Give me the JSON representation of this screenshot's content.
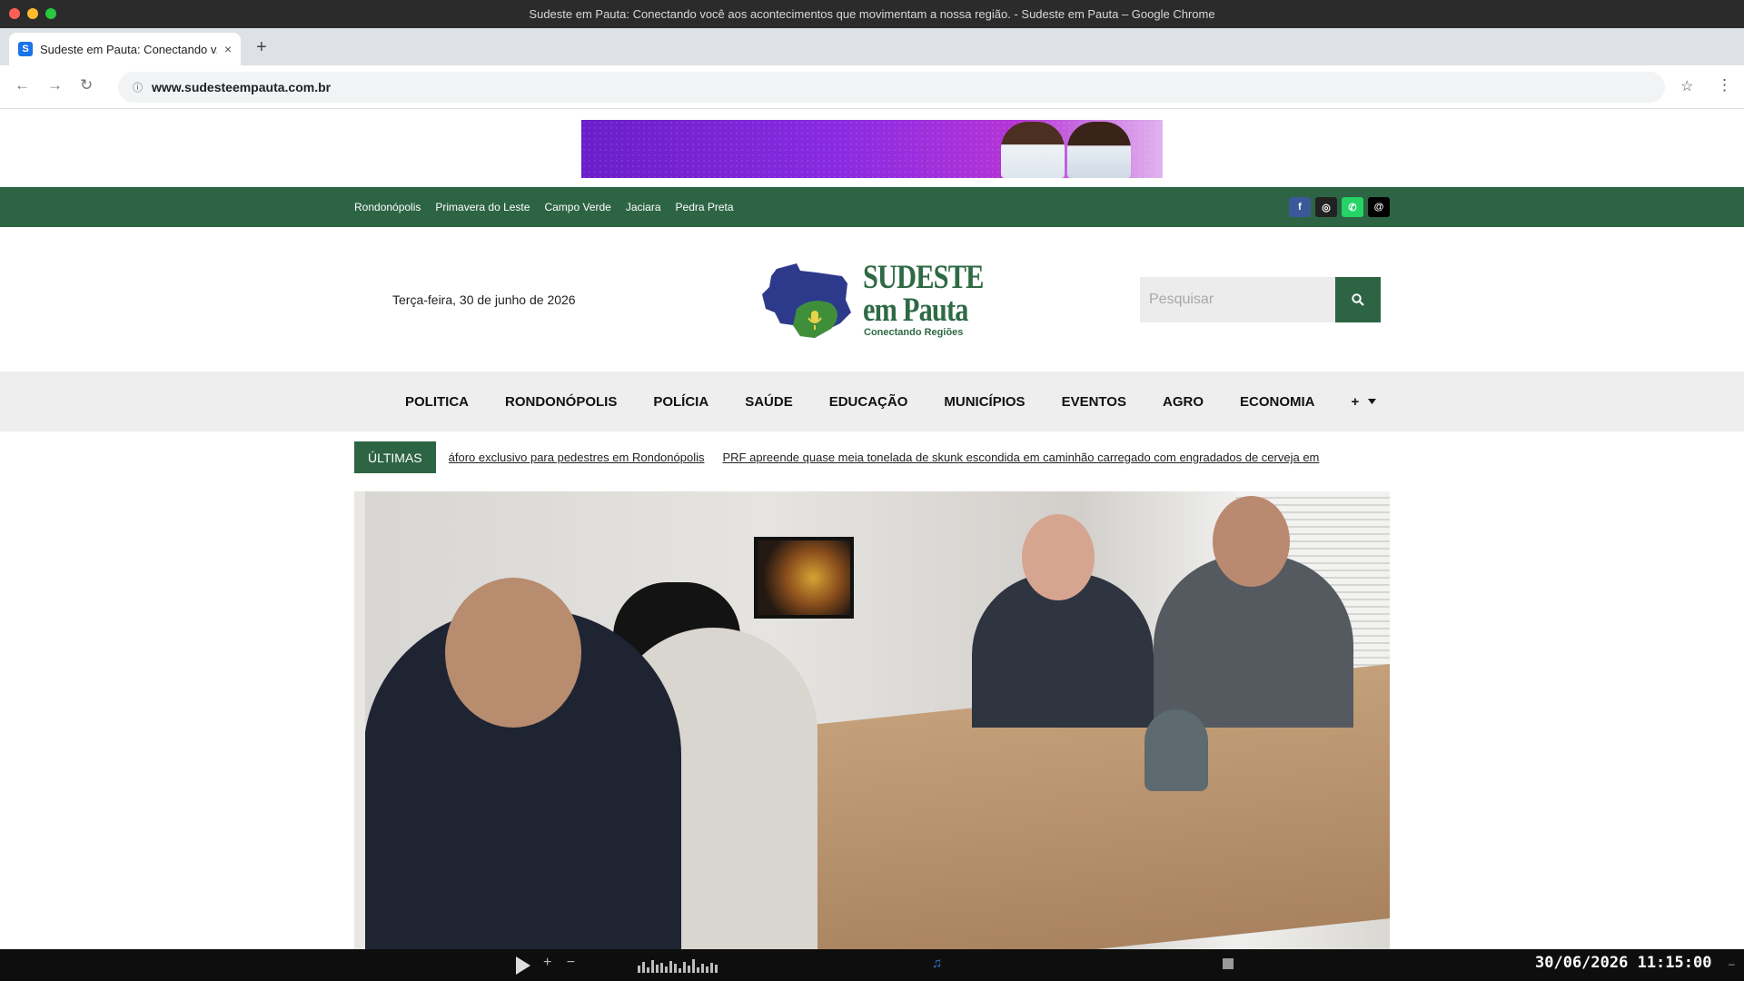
{
  "window": {
    "title": "Sudeste em Pauta: Conectando você aos acontecimentos que movimentam a nossa região. - Sudeste em Pauta – Google Chrome"
  },
  "tab": {
    "favicon_letter": "S",
    "title": "Sudeste em Pauta: Conectando v...",
    "close": "×",
    "new_tab": "+"
  },
  "toolbar": {
    "back": "←",
    "forward": "→",
    "reload": "↻",
    "url": "www.sudesteempauta.com.br",
    "star": "☆",
    "menu": "⋮"
  },
  "topbar": {
    "cities": [
      "Rondonópolis",
      "Primavera do Leste",
      "Campo Verde",
      "Jaciara",
      "Pedra Preta"
    ],
    "socials": [
      {
        "name": "facebook-icon",
        "glyph": "f",
        "color": "#3b5998"
      },
      {
        "name": "instagram-icon",
        "glyph": "◎",
        "color": "#222222"
      },
      {
        "name": "whatsapp-icon",
        "glyph": "✆",
        "color": "#25d366"
      },
      {
        "name": "threads-icon",
        "glyph": "@",
        "color": "#000000"
      }
    ]
  },
  "header": {
    "date": "Terça-feira, 30 de junho de 2026",
    "logo_title_line1": "SUDESTE",
    "logo_title_line2": "em Pauta",
    "logo_subtitle": "Conectando Regiões",
    "search_placeholder": "Pesquisar"
  },
  "nav": {
    "items": [
      "POLITICA",
      "RONDONÓPOLIS",
      "POLÍCIA",
      "SAÚDE",
      "EDUCAÇÃO",
      "MUNICÍPIOS",
      "EVENTOS",
      "AGRO",
      "ECONOMIA"
    ],
    "more": "+"
  },
  "ticker": {
    "label": "ÚLTIMAS",
    "items": [
      "áforo exclusivo para pedestres em Rondonópolis",
      "PRF apreende quase meia tonelada de skunk escondida em caminhão carregado com engradados de cerveja em"
    ]
  },
  "taskbar": {
    "clock": "30/06/2026 11:15:00",
    "vol_controls": "+ −",
    "minus": "–"
  },
  "colors": {
    "brand_green": "#2d6444",
    "banner_purple": "#7b2fd6"
  }
}
